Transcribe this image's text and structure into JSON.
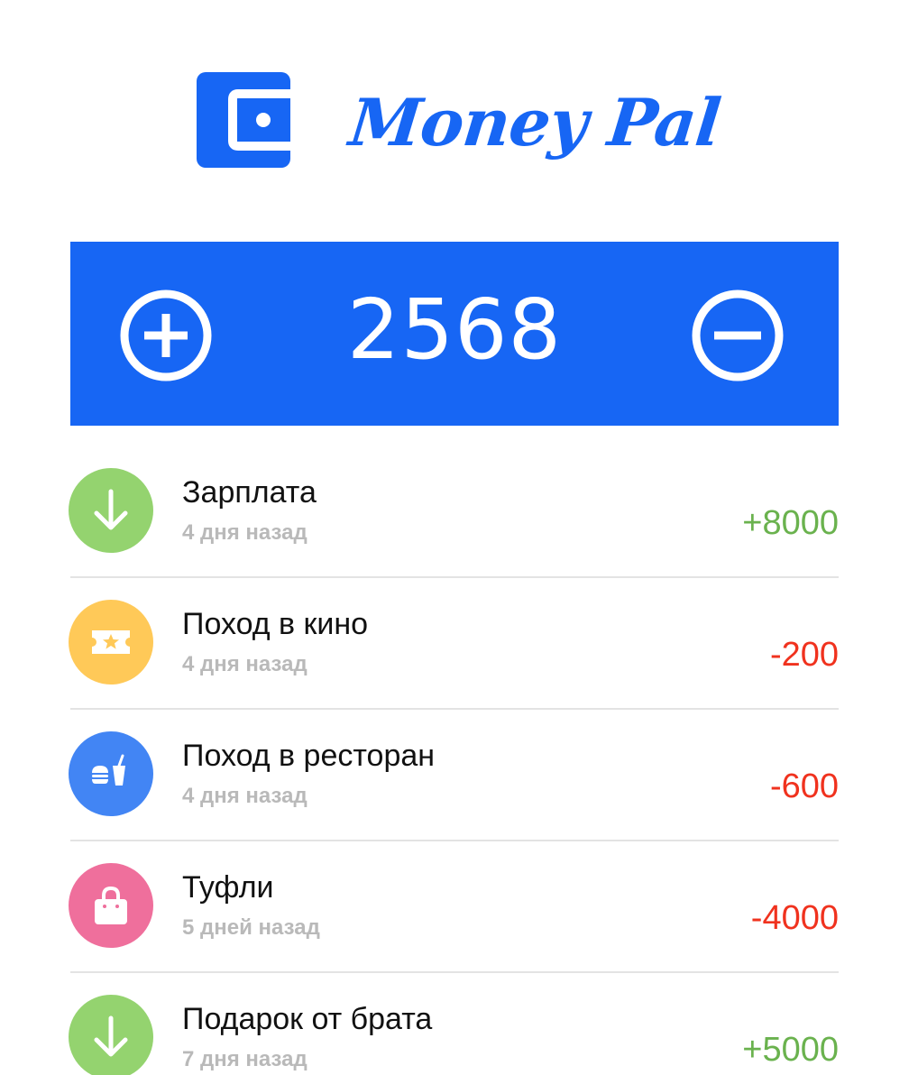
{
  "header": {
    "brand": "Money Pal",
    "logo_icon": "wallet-icon",
    "brand_color": "#1766f4"
  },
  "balance": {
    "value": "2568",
    "add_icon": "plus-circle-icon",
    "subtract_icon": "minus-circle-icon",
    "background": "#1766f4"
  },
  "transactions": [
    {
      "title": "Зарплата",
      "date": "4 дня назад",
      "amount": "+8000",
      "icon": "arrow-down-icon",
      "icon_color": "#94d36f",
      "type": "income"
    },
    {
      "title": "Поход в кино",
      "date": "4 дня назад",
      "amount": "-200",
      "icon": "ticket-icon",
      "icon_color": "#ffc958",
      "type": "expense"
    },
    {
      "title": "Поход в ресторан",
      "date": "4 дня назад",
      "amount": "-600",
      "icon": "fast-food-icon",
      "icon_color": "#4285f4",
      "type": "expense"
    },
    {
      "title": "Туфли",
      "date": "5 дней назад",
      "amount": "-4000",
      "icon": "shopping-bag-icon",
      "icon_color": "#ef6f9c",
      "type": "expense"
    },
    {
      "title": "Подарок от брата",
      "date": "7 дня назад",
      "amount": "+5000",
      "icon": "arrow-down-icon",
      "icon_color": "#94d36f",
      "type": "income"
    }
  ],
  "colors": {
    "income": "#6ab24e",
    "expense": "#f0321e"
  }
}
